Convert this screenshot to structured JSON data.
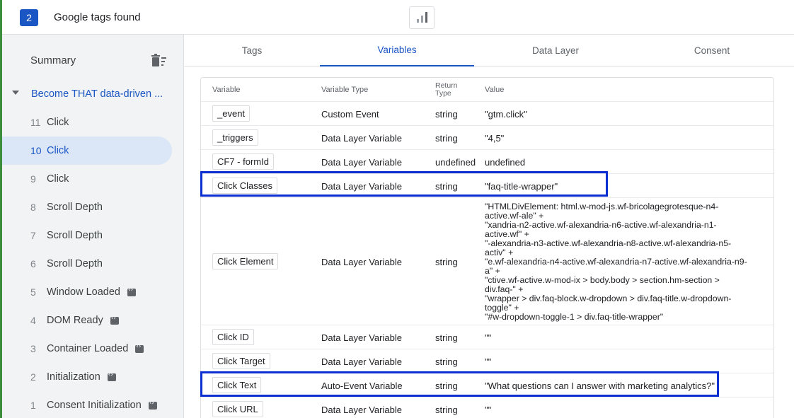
{
  "topbar": {
    "count": "2",
    "title": "Google tags found"
  },
  "sidebar": {
    "summary_label": "Summary",
    "container_name": "Become THAT data-driven ...",
    "events": [
      {
        "num": "11",
        "name": "Click",
        "code": false,
        "selected": false
      },
      {
        "num": "10",
        "name": "Click",
        "code": false,
        "selected": true
      },
      {
        "num": "9",
        "name": "Click",
        "code": false,
        "selected": false
      },
      {
        "num": "8",
        "name": "Scroll Depth",
        "code": false,
        "selected": false
      },
      {
        "num": "7",
        "name": "Scroll Depth",
        "code": false,
        "selected": false
      },
      {
        "num": "6",
        "name": "Scroll Depth",
        "code": false,
        "selected": false
      },
      {
        "num": "5",
        "name": "Window Loaded",
        "code": true,
        "selected": false
      },
      {
        "num": "4",
        "name": "DOM Ready",
        "code": true,
        "selected": false
      },
      {
        "num": "3",
        "name": "Container Loaded",
        "code": true,
        "selected": false
      },
      {
        "num": "2",
        "name": "Initialization",
        "code": true,
        "selected": false
      },
      {
        "num": "1",
        "name": "Consent Initialization",
        "code": true,
        "selected": false
      }
    ]
  },
  "tabs": [
    {
      "label": "Tags",
      "active": false
    },
    {
      "label": "Variables",
      "active": true
    },
    {
      "label": "Data Layer",
      "active": false
    },
    {
      "label": "Consent",
      "active": false
    }
  ],
  "table": {
    "headers": {
      "variable": "Variable",
      "type": "Variable Type",
      "return_type_1": "Return",
      "return_type_2": "Type",
      "value": "Value"
    },
    "rows": [
      {
        "variable": "_event",
        "type": "Custom Event",
        "return_type": "string",
        "value": "\"gtm.click\""
      },
      {
        "variable": "_triggers",
        "type": "Data Layer Variable",
        "return_type": "string",
        "value": "\"4,5\""
      },
      {
        "variable": "CF7 - formId",
        "type": "Data Layer Variable",
        "return_type": "undefined",
        "value": "undefined"
      },
      {
        "variable": "Click Classes",
        "type": "Data Layer Variable",
        "return_type": "string",
        "value": "\"faq-title-wrapper\"",
        "highlighted": true
      },
      {
        "variable": "Click Element",
        "type": "Data Layer Variable",
        "return_type": "string",
        "value_lines": [
          "\"HTMLDivElement: html.w-mod-js.wf-bricolagegrotesque-n4-",
          "active.wf-ale\" +",
          "\"xandria-n2-active.wf-alexandria-n6-active.wf-alexandria-n1-",
          "active.wf\" +",
          "\"-alexandria-n3-active.wf-alexandria-n8-active.wf-alexandria-n5-",
          "activ\" +",
          "\"e.wf-alexandria-n4-active.wf-alexandria-n7-active.wf-alexandria-n9-",
          "a\" +",
          "\"ctive.wf-active.w-mod-ix > body.body > section.hm-section >",
          "div.faq-\" +",
          "\"wrapper > div.faq-block.w-dropdown > div.faq-title.w-dropdown-",
          "toggle\" +",
          "\"#w-dropdown-toggle-1 > div.faq-title-wrapper\""
        ]
      },
      {
        "variable": "Click ID",
        "type": "Data Layer Variable",
        "return_type": "string",
        "value": "\"\""
      },
      {
        "variable": "Click Target",
        "type": "Data Layer Variable",
        "return_type": "string",
        "value": "\"\""
      },
      {
        "variable": "Click Text",
        "type": "Auto-Event Variable",
        "return_type": "string",
        "value": "\"What questions can I answer with marketing analytics?\"",
        "highlighted": true
      },
      {
        "variable": "Click URL",
        "type": "Data Layer Variable",
        "return_type": "string",
        "value": "\"\""
      }
    ]
  },
  "colors": {
    "accent": "#1a56c4",
    "highlight_box": "#0b2fd1",
    "sidebar_bg": "#f1f3f4",
    "selected_bg": "#dbe6f7"
  }
}
